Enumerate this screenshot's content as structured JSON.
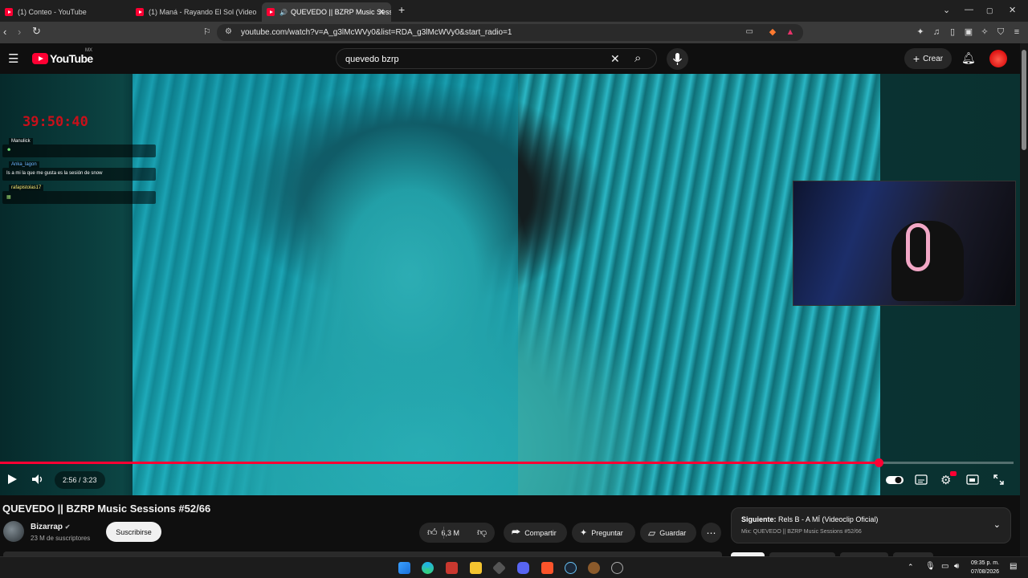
{
  "browser": {
    "tabs": [
      {
        "label": "(1) Conteo - YouTube"
      },
      {
        "label": "(1) Maná - Rayando El Sol (Video Ofi"
      },
      {
        "label": "QUEVEDO || BZRP Music Sess",
        "active": true
      }
    ],
    "new_tab": "+",
    "url": "youtube.com/watch?v=A_g3lMcWVy0&list=RDA_g3lMcWVy0&start_radio=1",
    "controls": {
      "minimize": "⌄",
      "restore": "—",
      "maximize": "▢",
      "close": "✕"
    }
  },
  "youtube": {
    "logo_word": "YouTube",
    "region": "MX",
    "search_value": "quevedo bzrp",
    "create_label": "Crear"
  },
  "overlay": {
    "timer": "39:50:40",
    "chat": [
      {
        "user": "Manulick",
        "message": ""
      },
      {
        "user": "Anka_lagon",
        "message": "Is a mi la que me gusta es la sesión de snow"
      },
      {
        "user": "rafapistolas17",
        "message": ""
      }
    ]
  },
  "player": {
    "time": "2:56 / 3:23",
    "progress_fraction": 0.867
  },
  "video": {
    "title": "QUEVEDO || BZRP Music Sessions #52/66",
    "channel": "Bizarrap",
    "subscribers": "23 M de suscriptores",
    "subscribe_label": "Suscribirse",
    "likes": "6,3 M",
    "share_label": "Compartir",
    "ask_label": "Preguntar",
    "save_label": "Guardar"
  },
  "up_next": {
    "label": "Siguiente:",
    "title": "Rels B - A MÍ (Videoclip Oficial)",
    "subtitle": "Mix: QUEVEDO || BZRP Music Sessions #52/66"
  },
  "taskbar": {
    "time": "09:35 p. m.",
    "date": "07/08/2026"
  },
  "colors": {
    "accent": "#ff0033",
    "background": "#0f0f0f"
  }
}
